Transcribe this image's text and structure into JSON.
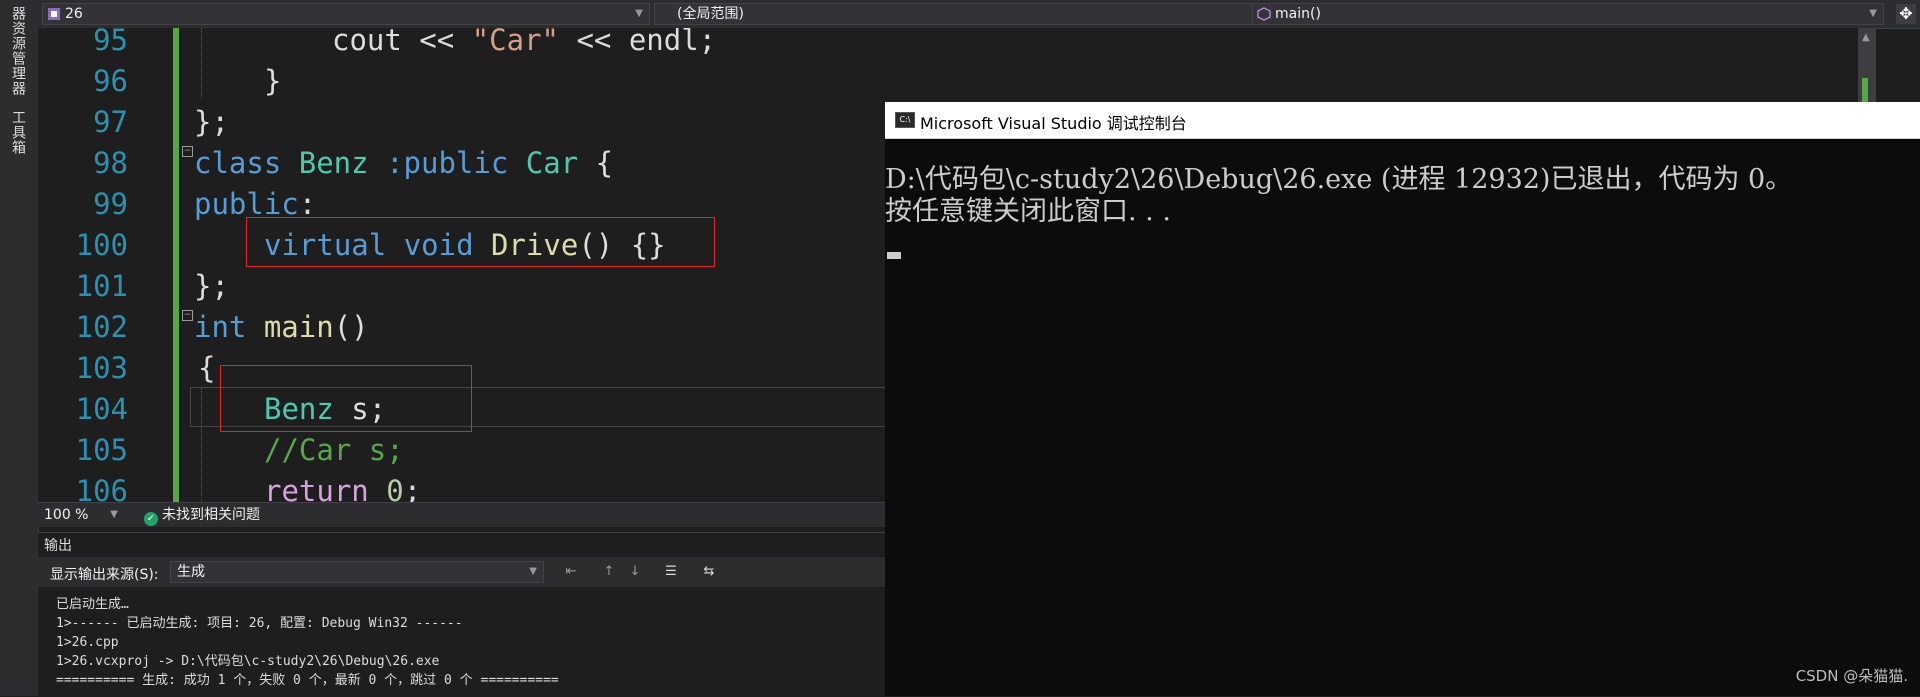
{
  "side_tabs": [
    "器资源管理器",
    "工具箱"
  ],
  "nav": {
    "project": "26",
    "scope": "(全局范围)",
    "member": "main()"
  },
  "editor": {
    "line_numbers": [
      "95",
      "96",
      "97",
      "98",
      "99",
      "100",
      "101",
      "102",
      "103",
      "104",
      "105",
      "106"
    ],
    "lines": {
      "l95": [
        "cout << ",
        "\"Car\"",
        " << endl;"
      ],
      "l96": "}",
      "l97": "};",
      "l98": [
        "class ",
        "Benz",
        " :public ",
        "Car",
        " {"
      ],
      "l99": [
        "public",
        ":"
      ],
      "l100": [
        "virtual ",
        "void ",
        "Drive",
        "() {}"
      ],
      "l101": "};",
      "l102": [
        "int ",
        "main",
        "()"
      ],
      "l103": "{",
      "l104": [
        "Benz",
        " s;"
      ],
      "l105": "//Car s;",
      "l106": [
        "return ",
        "0",
        ";"
      ]
    },
    "highlight_color": "#e0262a"
  },
  "status": {
    "zoom": "100 %",
    "issues": "未找到相关问题"
  },
  "output": {
    "title": "输出",
    "source_label": "显示输出来源(S):",
    "source_value": "生成",
    "log": [
      "已启动生成…",
      "1>------ 已启动生成: 项目: 26, 配置: Debug Win32 ------",
      "1>26.cpp",
      "1>26.vcxproj -> D:\\代码包\\c-study2\\26\\Debug\\26.exe",
      "========== 生成: 成功 1 个，失败 0 个，最新 0 个，跳过 0 个 =========="
    ]
  },
  "console": {
    "title": "Microsoft Visual Studio 调试控制台",
    "lines": [
      "D:\\代码包\\c-study2\\26\\Debug\\26.exe (进程 12932)已退出，代码为 0。",
      "按任意键关闭此窗口. . ."
    ]
  },
  "watermark": "CSDN @朵猫猫.",
  "icons": [
    "project-icon",
    "member-icon",
    "split-icon",
    "check-icon",
    "console-app-icon"
  ]
}
